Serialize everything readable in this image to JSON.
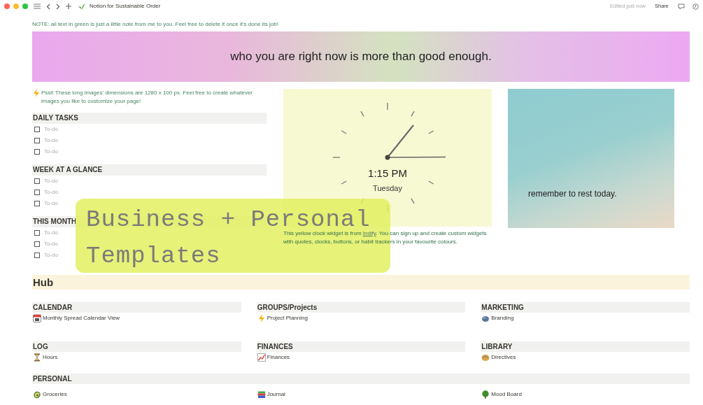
{
  "titlebar": {
    "title": "Notion for Sustainable Order",
    "edited": "Edited just now",
    "share": "Share"
  },
  "note": "NOTE: all text in green is just a little note from me to you. Feel free to delete it once it's done its job!",
  "banner": {
    "text": "who you are right now is more than good enough."
  },
  "tip": "Psst! These long images' dimensions are 1280 x 100 px. Feel free to create whatever images you like to customize your page!",
  "task_sections": [
    {
      "heading": "DAILY TASKS",
      "todos": [
        {
          "label": "To-do",
          "checked": false
        },
        {
          "label": "To-do",
          "checked": false
        },
        {
          "label": "To-do",
          "checked": false
        }
      ]
    },
    {
      "heading": "WEEK AT A GLANCE",
      "todos": [
        {
          "label": "To-do",
          "checked": false
        },
        {
          "label": "To-do",
          "checked": false
        },
        {
          "label": "To-do",
          "checked": false
        }
      ]
    },
    {
      "heading": "THIS MONTH",
      "todos": [
        {
          "label": "To-do",
          "checked": false
        },
        {
          "label": "To-do",
          "checked": false
        },
        {
          "label": "To-do",
          "checked": false
        }
      ]
    }
  ],
  "clock_widget": {
    "time": "1:15 PM",
    "day": "Tuesday",
    "caption_before": "This yellow clock widget is from ",
    "link": "Indify",
    "caption_after": ". You can sign up and create custom widgets with quotes, clocks, buttons, or habit trackers in your favourite colours."
  },
  "rest_card": {
    "text": "remember to rest today."
  },
  "overlay": {
    "lines": [
      "Business + Personal",
      "Templates"
    ]
  },
  "hub": {
    "title": "Hub",
    "sections": [
      {
        "heading": "CALENDAR",
        "links": [
          {
            "label": "Monthly Spread Calendar View",
            "kind": "calendar"
          }
        ]
      },
      {
        "heading": "GROUPS/Projects",
        "links": [
          {
            "label": "Project Planning",
            "kind": "bolt"
          }
        ]
      },
      {
        "heading": "MARKETING",
        "links": [
          {
            "label": "Branding",
            "kind": "blob"
          }
        ]
      },
      {
        "heading": "LOG",
        "links": [
          {
            "label": "Hours",
            "kind": "hourglass"
          }
        ]
      },
      {
        "heading": "FINANCES",
        "links": [
          {
            "label": "Finances",
            "kind": "chart"
          }
        ]
      },
      {
        "heading": "LIBRARY",
        "links": [
          {
            "label": "Directives",
            "kind": "palette"
          }
        ]
      }
    ],
    "personal": {
      "heading": "PERSONAL",
      "links": [
        {
          "label": "Groceries",
          "kind": "avocado"
        },
        {
          "label": "Journal",
          "kind": "books"
        },
        {
          "label": "Mood Board",
          "kind": "tree"
        }
      ]
    }
  }
}
